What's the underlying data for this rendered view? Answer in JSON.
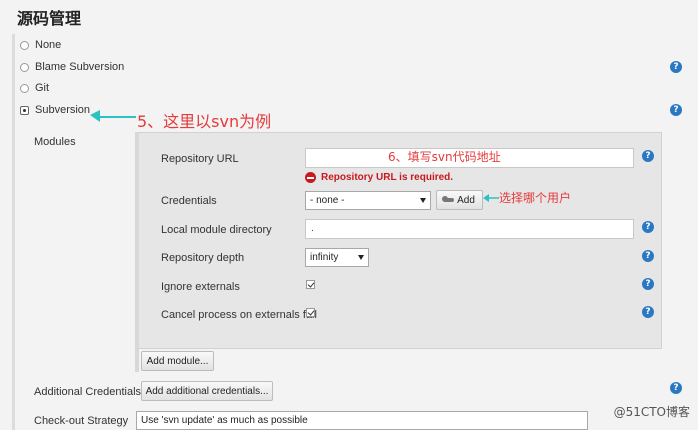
{
  "section_title": "源码管理",
  "scm_options": [
    {
      "label": "None",
      "selected": false
    },
    {
      "label": "Blame Subversion",
      "selected": false
    },
    {
      "label": "Git",
      "selected": false
    },
    {
      "label": "Subversion",
      "selected": true
    }
  ],
  "annotations": {
    "step5": "5、这里以svn为例",
    "step6": "6、填写svn代码地址",
    "credentials_hint": "选择哪个用户"
  },
  "labels": {
    "modules": "Modules",
    "repository_url": "Repository URL",
    "credentials": "Credentials",
    "local_module_directory": "Local module directory",
    "repository_depth": "Repository depth",
    "ignore_externals": "Ignore externals",
    "cancel_process": "Cancel process on externals fail",
    "additional_credentials": "Additional Credentials",
    "checkout_strategy": "Check-out Strategy"
  },
  "fields": {
    "repository_url_value": "",
    "repository_url_error": "Repository URL is required.",
    "credentials_selected": "- none -",
    "local_module_directory_value": ".",
    "repository_depth_selected": "infinity",
    "ignore_externals_checked": true,
    "cancel_process_checked": true,
    "checkout_strategy_selected": "Use 'svn update' as much as possible"
  },
  "buttons": {
    "add_credentials": "Add",
    "add_module": "Add module...",
    "add_additional_credentials": "Add additional credentials..."
  },
  "help_glyph": "?",
  "watermark": "@51CTO博客",
  "colors": {
    "annotation_red": "#e53b3b",
    "annotation_arrow": "#2bc2c2",
    "error_red": "#c8191e",
    "help_blue": "#2a78c2"
  }
}
